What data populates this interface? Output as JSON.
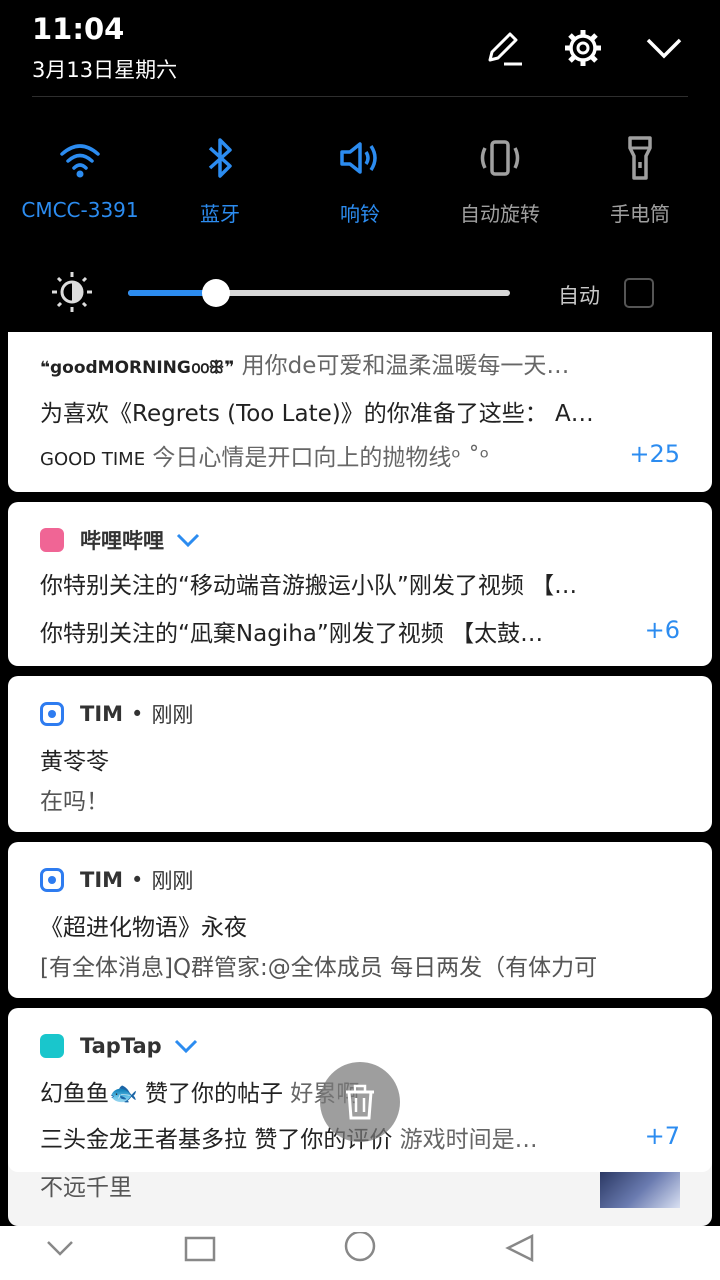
{
  "status": {
    "time": "11:04",
    "date": "3月13日星期六"
  },
  "header_icons": [
    "edit-icon",
    "gear-icon",
    "chevron-down-icon"
  ],
  "quick_settings": [
    {
      "id": "wifi",
      "label": "CMCC-3391",
      "icon": "wifi-icon",
      "active": true
    },
    {
      "id": "bluetooth",
      "label": "蓝牙",
      "icon": "bluetooth-icon",
      "active": true
    },
    {
      "id": "sound",
      "label": "响铃",
      "icon": "speaker-icon",
      "active": true
    },
    {
      "id": "rotate",
      "label": "自动旋转",
      "icon": "rotate-icon",
      "active": false
    },
    {
      "id": "flashlight",
      "label": "手电筒",
      "icon": "flashlight-icon",
      "active": false
    }
  ],
  "brightness": {
    "level": 0.23,
    "auto_label": "自动",
    "auto_checked": false
  },
  "colors": {
    "accent": "#2c8cf0",
    "bilibili": "#f06595",
    "tim": "#2e7cf0",
    "taptap": "#19c6cc"
  },
  "notifications": {
    "music": {
      "lines": [
        {
          "prefix": "❝goodMORNING൦൦ꕥ❞",
          "text": "用你de可爱和温柔温暖每一天…"
        },
        {
          "prefix": "",
          "text": "为喜欢《Regrets (Too Late)》的你准备了这些： A…"
        },
        {
          "prefix": "GOOD TIME",
          "text": "今日心情是开口向上的抛物线ᵒ ˚ᵒ"
        }
      ],
      "count": "+25"
    },
    "bilibili": {
      "app": "哔哩哔哩",
      "lines": [
        "你特别关注的“移动端音游搬运小队”刚发了视频 【…",
        "你特别关注的“凪棄Nagiha”刚发了视频 【太鼓…"
      ],
      "count": "+6"
    },
    "tim1": {
      "app": "TIM",
      "when": "刚刚",
      "title": "黄苓苓",
      "body": "在吗！"
    },
    "tim2": {
      "app": "TIM",
      "when": "刚刚",
      "title": "《超进化物语》永夜",
      "body": "[有全体消息]Q群管家:@全体成员 每日两发（有体力可"
    },
    "taptap": {
      "app": "TapTap",
      "line1": {
        "name": "幻鱼鱼🐟",
        "text": "赞了你的帖子",
        "extra": "好累啊"
      },
      "line2": {
        "name": "三头金龙王者基多拉",
        "text": "赞了你的评价",
        "extra": "游戏时间是…"
      },
      "count": "+7"
    },
    "underneath": {
      "text": "不远千里"
    }
  },
  "overlay": {
    "icon": "trash-icon"
  },
  "navbar": [
    "back-icon",
    "home-icon",
    "recents-icon"
  ]
}
